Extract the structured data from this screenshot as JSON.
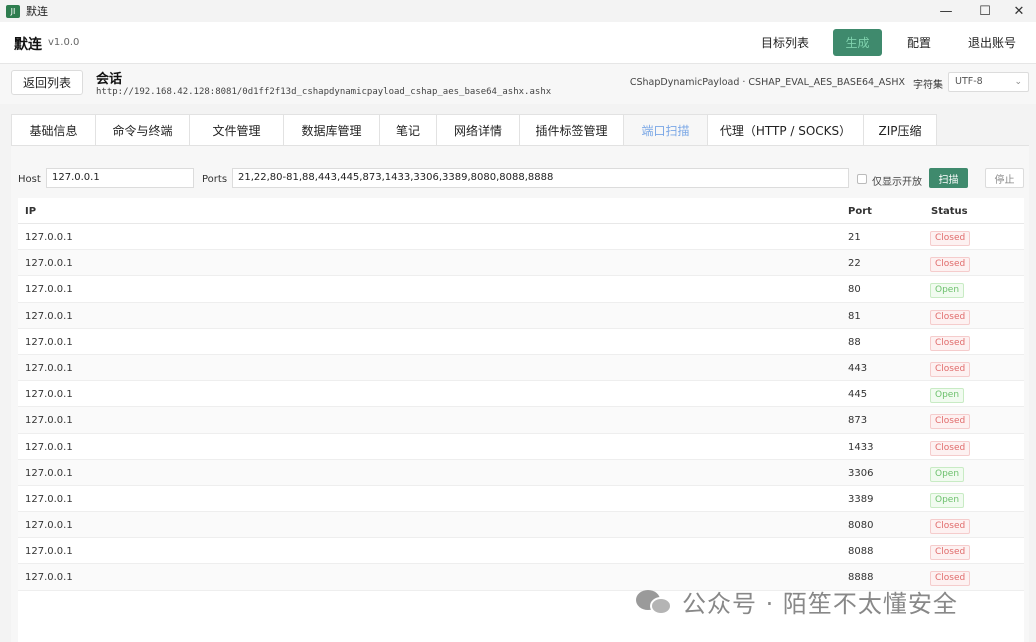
{
  "window": {
    "title": "默连",
    "icon_text": "JI"
  },
  "header": {
    "brand": "默连",
    "version": "v1.0.0",
    "nav": [
      "目标列表",
      "生成",
      "配置",
      "退出账号"
    ]
  },
  "session": {
    "back_label": "返回列表",
    "title": "会话",
    "url": "http://192.168.42.128:8081/0d1ff2f13d_cshapdynamicpayload_cshap_aes_base64_ashx.ashx",
    "payload": "CShapDynamicPayload · CSHAP_EVAL_AES_BASE64_ASHX",
    "charset_label": "字符集",
    "charset_value": "UTF-8"
  },
  "tabs": [
    "基础信息",
    "命令与终端",
    "文件管理",
    "数据库管理",
    "笔记",
    "网络详情",
    "插件标签管理",
    "端口扫描",
    "代理（HTTP / SOCKS）",
    "ZIP压缩"
  ],
  "active_tab": "端口扫描",
  "scan": {
    "host_label": "Host",
    "host_value": "127.0.0.1",
    "ports_label": "Ports",
    "ports_value": "21,22,80-81,88,443,445,873,1433,3306,3389,8080,8088,8888",
    "open_only_label": "仅显示开放",
    "scan_label": "扫描",
    "stop_label": "停止"
  },
  "table": {
    "headers": [
      "IP",
      "Port",
      "Status"
    ],
    "rows": [
      {
        "ip": "127.0.0.1",
        "port": "21",
        "status": "Closed"
      },
      {
        "ip": "127.0.0.1",
        "port": "22",
        "status": "Closed"
      },
      {
        "ip": "127.0.0.1",
        "port": "80",
        "status": "Open"
      },
      {
        "ip": "127.0.0.1",
        "port": "81",
        "status": "Closed"
      },
      {
        "ip": "127.0.0.1",
        "port": "88",
        "status": "Closed"
      },
      {
        "ip": "127.0.0.1",
        "port": "443",
        "status": "Closed"
      },
      {
        "ip": "127.0.0.1",
        "port": "445",
        "status": "Open"
      },
      {
        "ip": "127.0.0.1",
        "port": "873",
        "status": "Closed"
      },
      {
        "ip": "127.0.0.1",
        "port": "1433",
        "status": "Closed"
      },
      {
        "ip": "127.0.0.1",
        "port": "3306",
        "status": "Open"
      },
      {
        "ip": "127.0.0.1",
        "port": "3389",
        "status": "Open"
      },
      {
        "ip": "127.0.0.1",
        "port": "8080",
        "status": "Closed"
      },
      {
        "ip": "127.0.0.1",
        "port": "8088",
        "status": "Closed"
      },
      {
        "ip": "127.0.0.1",
        "port": "8888",
        "status": "Closed"
      }
    ]
  },
  "watermark": "公众号 · 陌笙不太懂安全",
  "colors": {
    "accent": "#3f8a6d",
    "tab_active": "#7aa7e6",
    "closed": "#e06c6c",
    "open": "#6cc06c"
  }
}
